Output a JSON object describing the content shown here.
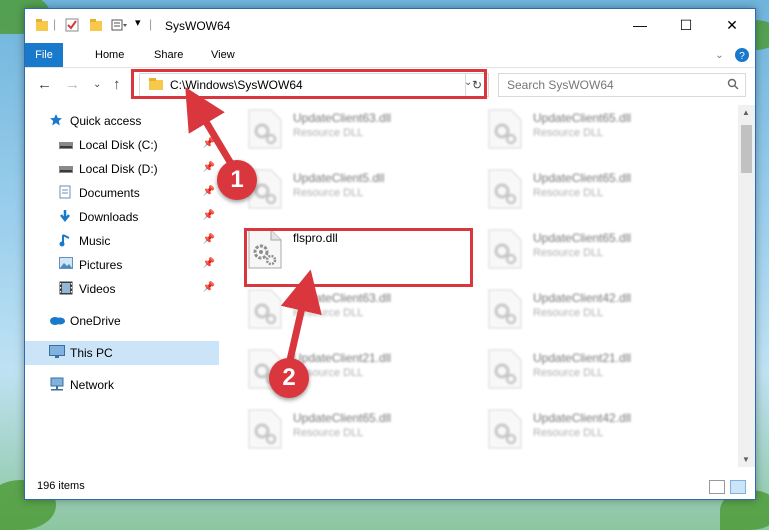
{
  "window": {
    "title": "SysWOW64"
  },
  "ribbon": {
    "tabs": [
      "File",
      "Home",
      "Share",
      "View"
    ]
  },
  "address_bar": {
    "path": "C:\\Windows\\SysWOW64"
  },
  "search": {
    "placeholder": "Search SysWOW64"
  },
  "sidebar": {
    "items": [
      {
        "label": "Quick access",
        "icon": "star-icon"
      },
      {
        "label": "Local Disk (C:)",
        "icon": "drive-icon",
        "pinned": true
      },
      {
        "label": "Local Disk (D:)",
        "icon": "drive-icon",
        "pinned": true
      },
      {
        "label": "Documents",
        "icon": "documents-icon",
        "pinned": true
      },
      {
        "label": "Downloads",
        "icon": "download-icon",
        "pinned": true
      },
      {
        "label": "Music",
        "icon": "music-icon",
        "pinned": true
      },
      {
        "label": "Pictures",
        "icon": "pictures-icon",
        "pinned": true
      },
      {
        "label": "Videos",
        "icon": "video-icon",
        "pinned": true
      },
      {
        "label": "OneDrive",
        "icon": "cloud-icon"
      },
      {
        "label": "This PC",
        "icon": "computer-icon",
        "selected": true
      },
      {
        "label": "Network",
        "icon": "network-icon"
      }
    ]
  },
  "files": {
    "col1": [
      {
        "name": "UpdateClient63.dll",
        "type": "Resource DLL"
      },
      {
        "name": "UpdateClient5.dll",
        "type": "Resource DLL"
      },
      {
        "name": "flspro.dll",
        "type": ""
      },
      {
        "name": "UpdateClient63.dll",
        "type": "Resource DLL"
      },
      {
        "name": "UpdateClient21.dll",
        "type": "Resource DLL"
      },
      {
        "name": "UpdateClient65.dll",
        "type": "Resource DLL"
      }
    ],
    "col2": [
      {
        "name": "UpdateClient65.dll",
        "type": "Resource DLL"
      },
      {
        "name": "UpdateClient65.dll",
        "type": "Resource DLL"
      },
      {
        "name": "UpdateClient65.dll",
        "type": "Resource DLL"
      },
      {
        "name": "UpdateClient42.dll",
        "type": "Resource DLL"
      },
      {
        "name": "UpdateClient21.dll",
        "type": "Resource DLL"
      },
      {
        "name": "UpdateClient42.dll",
        "type": "Resource DLL"
      }
    ]
  },
  "status": {
    "item_count": "196 items"
  },
  "annotations": {
    "step1": "1",
    "step2": "2",
    "color": "#d9363e"
  }
}
